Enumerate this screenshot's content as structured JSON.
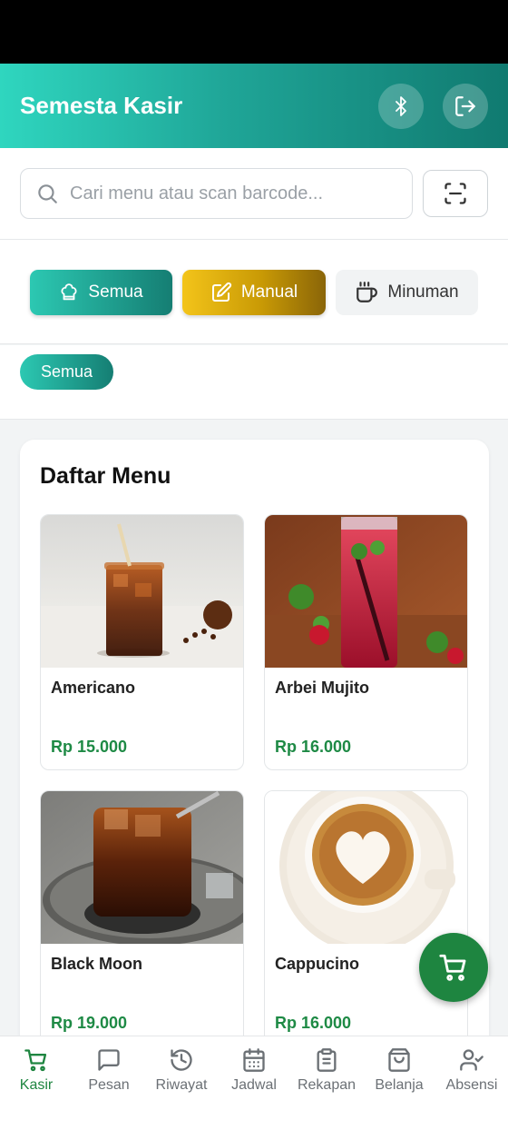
{
  "header": {
    "title": "Semesta Kasir",
    "bluetooth_icon": "bluetooth-icon",
    "logout_icon": "logout-icon"
  },
  "search": {
    "placeholder": "Cari menu atau scan barcode...",
    "value": ""
  },
  "categories": [
    {
      "label": "Semua",
      "icon": "chef-hat-icon",
      "active": true
    },
    {
      "label": "Manual",
      "icon": "edit-icon",
      "active": false
    },
    {
      "label": "Minuman",
      "icon": "coffee-cup-icon",
      "active": false
    }
  ],
  "subcategory": {
    "label": "Semua"
  },
  "menu": {
    "title": "Daftar Menu",
    "items": [
      {
        "name": "Americano",
        "price": "Rp 15.000"
      },
      {
        "name": "Arbei Mujito",
        "price": "Rp 16.000"
      },
      {
        "name": "Black Moon",
        "price": "Rp 19.000"
      },
      {
        "name": "Cappucino",
        "price": "Rp 16.000"
      }
    ]
  },
  "nav": [
    {
      "label": "Kasir",
      "icon": "cart-icon",
      "active": true
    },
    {
      "label": "Pesan",
      "icon": "message-icon",
      "active": false
    },
    {
      "label": "Riwayat",
      "icon": "history-icon",
      "active": false
    },
    {
      "label": "Jadwal",
      "icon": "calendar-icon",
      "active": false
    },
    {
      "label": "Rekapan",
      "icon": "clipboard-icon",
      "active": false
    },
    {
      "label": "Belanja",
      "icon": "shopping-bag-icon",
      "active": false
    },
    {
      "label": "Absensi",
      "icon": "user-check-icon",
      "active": false
    }
  ],
  "colors": {
    "primary": "#1fa597",
    "accent_green": "#1e8540",
    "manual_gold": "#e0ad10",
    "price_green": "#1e8a45"
  }
}
